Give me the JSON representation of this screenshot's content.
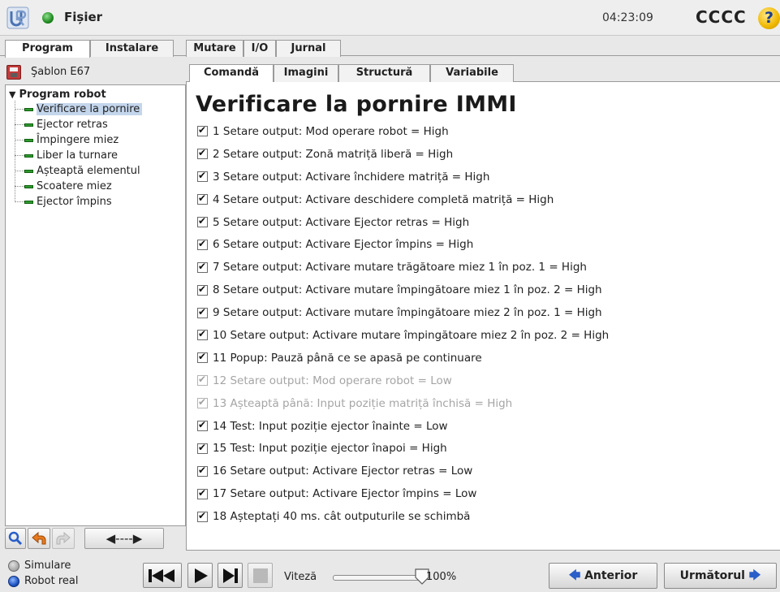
{
  "titlebar": {
    "menu_label": "Fișier",
    "clock": "04:23:09",
    "robot_name": "CCCC",
    "help_glyph": "?"
  },
  "main_tabs": [
    {
      "label": "Program",
      "active": true
    },
    {
      "label": "Instalare",
      "active": false
    },
    {
      "label": "Mutare",
      "active": false
    },
    {
      "label": "I/O",
      "active": false
    },
    {
      "label": "Jurnal",
      "active": false
    }
  ],
  "left_panel": {
    "template_name": "Şablon E67",
    "tree": {
      "root": "Program robot",
      "items": [
        {
          "label": "Verificare la pornire",
          "selected": true
        },
        {
          "label": "Ejector retras",
          "selected": false
        },
        {
          "label": "Împingere miez",
          "selected": false
        },
        {
          "label": "Liber la turnare",
          "selected": false
        },
        {
          "label": "Așteaptă elementul",
          "selected": false
        },
        {
          "label": "Scoatere miez",
          "selected": false
        },
        {
          "label": "Ejector împins",
          "selected": false
        }
      ]
    },
    "tools": {
      "step_arrows": "◀----▶"
    }
  },
  "sub_tabs": [
    {
      "label": "Comandă",
      "active": true
    },
    {
      "label": "Imagini",
      "active": false
    },
    {
      "label": "Structură",
      "active": false
    },
    {
      "label": "Variabile",
      "active": false
    }
  ],
  "content": {
    "title": "Verificare la pornire IMMI",
    "commands": [
      {
        "text": "1 Setare output: Mod operare robot = High",
        "checked": true,
        "enabled": true
      },
      {
        "text": "2 Setare output: Zonă matriță liberă = High",
        "checked": true,
        "enabled": true
      },
      {
        "text": "3 Setare output: Activare închidere matriță = High",
        "checked": true,
        "enabled": true
      },
      {
        "text": "4 Setare output: Activare deschidere completă matriță = High",
        "checked": true,
        "enabled": true
      },
      {
        "text": "5 Setare output: Activare Ejector retras = High",
        "checked": true,
        "enabled": true
      },
      {
        "text": "6 Setare output: Activare Ejector împins = High",
        "checked": true,
        "enabled": true
      },
      {
        "text": "7 Setare output: Activare mutare trăgătoare miez 1 în poz. 1 = High",
        "checked": true,
        "enabled": true
      },
      {
        "text": "8 Setare output: Activare mutare împingătoare miez 1 în poz. 2 = High",
        "checked": true,
        "enabled": true
      },
      {
        "text": "9 Setare output: Activare mutare împingătoare miez 2 în poz. 1 = High",
        "checked": true,
        "enabled": true
      },
      {
        "text": "10 Setare output: Activare mutare împingătoare miez 2 în poz. 2 = High",
        "checked": true,
        "enabled": true
      },
      {
        "text": "11 Popup: Pauză până ce se apasă pe continuare",
        "checked": true,
        "enabled": true
      },
      {
        "text": "12 Setare output: Mod operare robot = Low",
        "checked": true,
        "enabled": false
      },
      {
        "text": "13 Așteaptă până: Input poziție matriță închisă = High",
        "checked": true,
        "enabled": false
      },
      {
        "text": "14 Test: Input poziție ejector înainte = Low",
        "checked": true,
        "enabled": true
      },
      {
        "text": "15 Test: Input poziție ejector înapoi = High",
        "checked": true,
        "enabled": true
      },
      {
        "text": "16 Setare output: Activare Ejector retras = Low",
        "checked": true,
        "enabled": true
      },
      {
        "text": "17 Setare output: Activare Ejector împins = Low",
        "checked": true,
        "enabled": true
      },
      {
        "text": "18 Așteptați 40 ms. cât outputurile se schimbă",
        "checked": true,
        "enabled": true
      }
    ]
  },
  "bottom": {
    "mode_simulation": "Simulare",
    "mode_real": "Robot real",
    "speed_label": "Viteză",
    "speed_value": "100%",
    "speed_fraction": 1.0,
    "prev_label": "Anterior",
    "next_label": "Următorul"
  },
  "colors": {
    "status_ok": "#1f8a1f",
    "selection": "#c3d6ec",
    "node_green": "#2e9a2e",
    "accent_blue": "#2a5ec8",
    "disabled_text": "#a5a5a5"
  }
}
